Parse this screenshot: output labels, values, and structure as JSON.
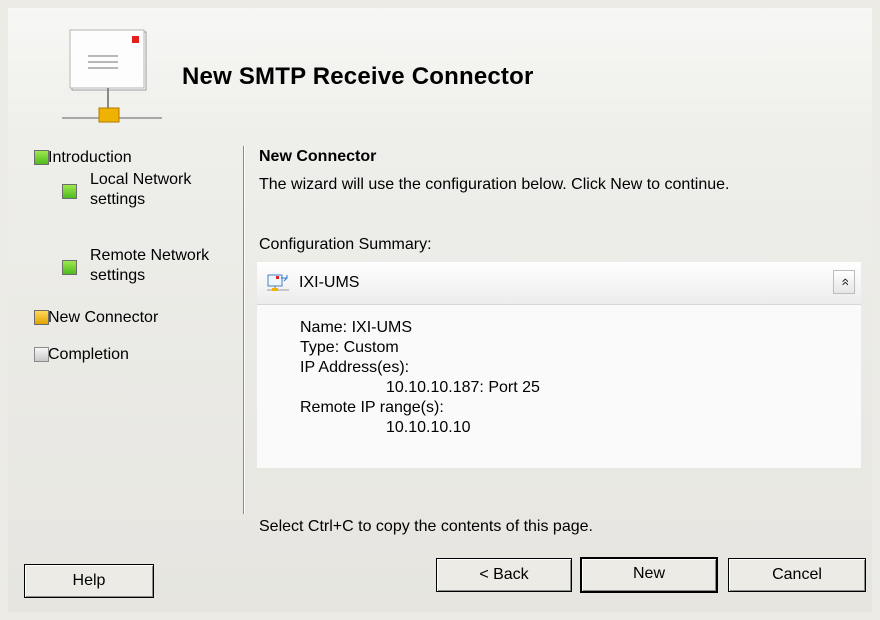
{
  "header": {
    "title": "New SMTP Receive Connector"
  },
  "steps": [
    {
      "label_line1": "Introduction",
      "label_line2": "",
      "status": "complete",
      "color": "#4fba1e"
    },
    {
      "label_line1": "Local Network",
      "label_line2": "settings",
      "status": "complete",
      "color": "#4fba1e"
    },
    {
      "label_line1": "Remote Network",
      "label_line2": "settings",
      "status": "complete",
      "color": "#4fba1e"
    },
    {
      "label_line1": "New Connector",
      "label_line2": "",
      "status": "current",
      "color": "#e0a400"
    },
    {
      "label_line1": "Completion",
      "label_line2": "",
      "status": "pending",
      "color": "#c9c9c9"
    }
  ],
  "content": {
    "section_title": "New Connector",
    "description": "The wizard will use the configuration below.  Click New to continue.",
    "summary_label": "Configuration Summary:",
    "summary": {
      "connector_name": "IXI-UMS",
      "collapse_glyph": "»",
      "lines": [
        "Name: IXI-UMS",
        "Type: Custom",
        "IP Address(es):",
        "10.10.10.187: Port 25",
        "Remote IP range(s):",
        "10.10.10.10"
      ]
    },
    "copy_hint": "Select Ctrl+C to copy the contents of this page."
  },
  "buttons": {
    "help": "Help",
    "back_prefix": "< ",
    "back": "Back",
    "new": "New",
    "cancel": "Cancel"
  }
}
